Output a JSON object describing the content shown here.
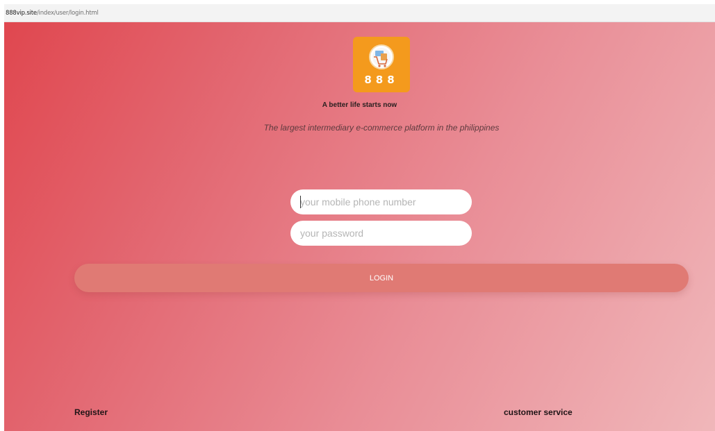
{
  "browser": {
    "url_host": "888vip.site",
    "url_path": "/index/user/login.html"
  },
  "brand": {
    "logo_text": "888",
    "logo_color": "#f49a1d",
    "tagline": "A better life starts now",
    "subtitle": "The largest intermediary e-commerce platform in the philippines"
  },
  "form": {
    "phone_placeholder": "your mobile phone number",
    "password_placeholder": "your password",
    "login_label": "LOGIN"
  },
  "footer": {
    "register_label": "Register",
    "customer_service_label": "customer service"
  },
  "colors": {
    "gradient_start": "#e0474f",
    "gradient_end": "#f0b7ba",
    "button": "#e07a74"
  }
}
